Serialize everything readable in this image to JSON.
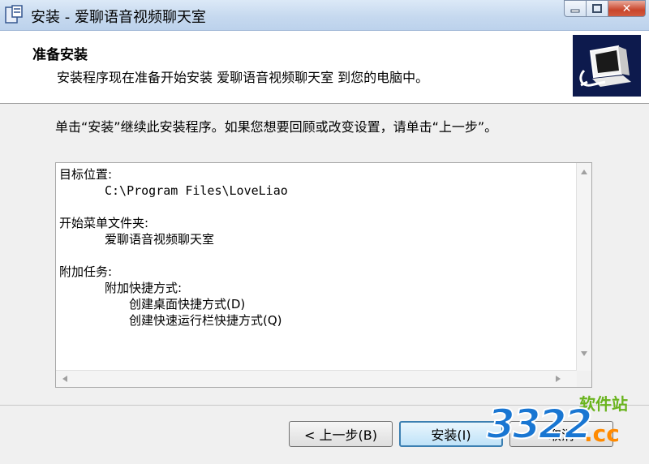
{
  "window": {
    "title": "安装 - 爱聊语音视频聊天室",
    "icons": {
      "app": "installer-app-icon",
      "min": "minimize-icon",
      "max": "maximize-icon",
      "close": "close-icon"
    }
  },
  "header": {
    "title": "准备安装",
    "description": "安装程序现在准备开始安装 爱聊语音视频聊天室 到您的电脑中。",
    "logo_icon": "computer-install-icon"
  },
  "body": {
    "instruction": "单击“安装”继续此安装程序。如果您想要回顾或改变设置，请单击“上一步”。"
  },
  "memo": {
    "dest_label": "目标位置:",
    "dest_path": "C:\\Program Files\\LoveLiao",
    "startmenu_label": "开始菜单文件夹:",
    "startmenu_value": "爱聊语音视频聊天室",
    "tasks_label": "附加任务:",
    "tasks_group": "附加快捷方式:",
    "task_1": "创建桌面快捷方式(D)",
    "task_2": "创建快速运行栏快捷方式(Q)"
  },
  "buttons": {
    "back": "< 上一步(B)",
    "install": "安装(I)",
    "cancel": "取消"
  },
  "watermark": {
    "number": "3322",
    "site": "软件站",
    "domain": ".cc"
  },
  "colors": {
    "header_logo_bg": "#0d1a4d",
    "close_red": "#c9452b",
    "default_button_border": "#3c7fb1",
    "watermark_green": "#6ab41e",
    "watermark_blue": "#1976d2",
    "watermark_orange": "#ff8a00"
  }
}
